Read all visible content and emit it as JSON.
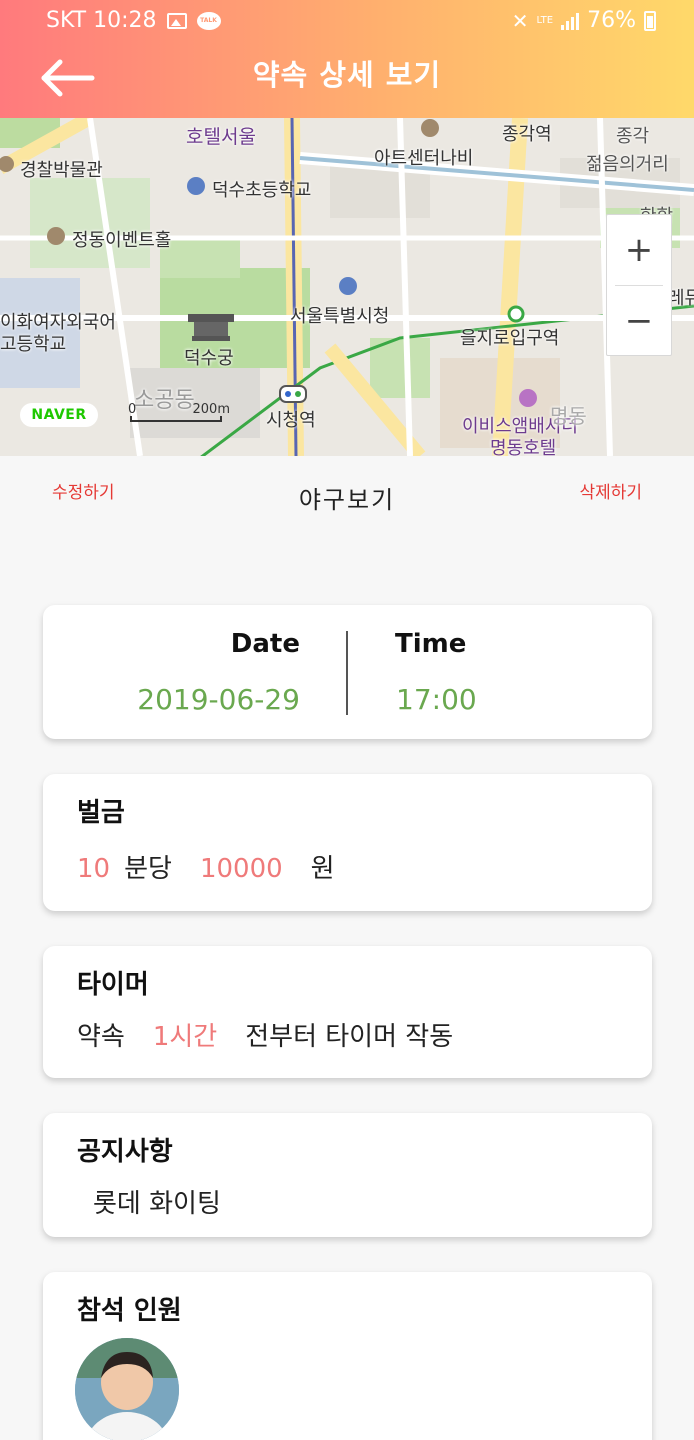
{
  "status_bar": {
    "carrier_time": "SKT 10:28",
    "talk_icon_text": "TALK",
    "network": "LTE",
    "battery": "76%"
  },
  "header": {
    "title": "약속 상세 보기"
  },
  "map": {
    "labels": {
      "hotel_seoul": "호텔서울",
      "jonggak_station": "종각역",
      "art_center": "아트센터나비",
      "jonggak_street": "종각",
      "jonggak_street2": "젊음의거리",
      "police_museum": "경찰박물관",
      "deoksu_school": "덕수초등학교",
      "jeongdong_event": "정동이벤트홀",
      "seoul_cityhall": "서울특별시청",
      "ewha": "이화여자외국어",
      "ewha2": "고등학교",
      "euljiro_station": "을지로입구역",
      "deoksugung": "덕수궁",
      "sogong": "소공동",
      "cityhall_station": "시청역",
      "ibis": "이비스앰배서더",
      "ibis2": "명동호텔",
      "hahak": "한학",
      "re": "레듀",
      "myeongdong": "명동"
    },
    "zoom_in": "+",
    "zoom_out": "−",
    "logo": "NAVER",
    "scale_zero": "0",
    "scale_label": "200m"
  },
  "actions": {
    "edit": "수정하기",
    "delete": "삭제하기"
  },
  "appointment": {
    "title": "야구보기",
    "date_label": "Date",
    "date_value": "2019-06-29",
    "time_label": "Time",
    "time_value": "17:00"
  },
  "penalty": {
    "heading": "벌금",
    "minutes": "10",
    "per": "분당",
    "amount": "10000",
    "unit": "원"
  },
  "timer": {
    "heading": "타이머",
    "prefix": "약속",
    "duration": "1시간",
    "suffix": "전부터 타이머 작동"
  },
  "notice": {
    "heading": "공지사항",
    "text": "롯데 화이팅"
  },
  "attendees": {
    "heading": "참석 인원"
  },
  "colors": {
    "header_start": "#ff7a7d",
    "header_end": "#ffd96a",
    "accent_red": "#e53935",
    "accent_pink": "#ef7a7a",
    "date_green": "#6aa84f"
  }
}
